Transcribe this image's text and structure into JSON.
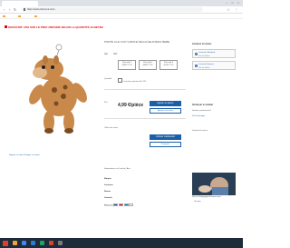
{
  "browser": {
    "tab_title": "",
    "address": "https://www.cdiscount.com/...",
    "bookmarks": [
      "",
      "",
      ""
    ]
  },
  "promo": {
    "text": "DISCOUNT: 20% SUR LE PRIX UNITAIRE SELON LA QUANTITÉ ACHETÉE"
  },
  "product": {
    "title": "PORTE CLE CUIT GIRAFE PELUCHE ANIMAL BEBE",
    "option_label": "Qté",
    "option_value": "Noir",
    "sizes": [
      {
        "line1": "Prix unit 1",
        "line2": "4,99 € TTC"
      },
      {
        "line1": "Prix unit 2",
        "line2": "4,89 € TTC"
      },
      {
        "line1": "Prix unit 3",
        "line2": "4,79 € TTC"
      }
    ],
    "quantity_label": "Quantité",
    "checkbox_label": "Livraison gratuite dès 25€",
    "price": "4,99 €/pièce",
    "price_sub": "",
    "buy_button": "Ajouter au panier",
    "wishlist_button": "Ajouter à ma liste",
    "section_label": "Offres de vente",
    "cart_button": "Acheter maintenant",
    "secondary_button": "Comparer"
  },
  "sidebar": {
    "delivery_header": "Livraison et retours",
    "delivery_option_1_title": "Livraison Standard",
    "delivery_option_1_sub": "Voir les délais",
    "delivery_option_2_title": "Livraison Express",
    "delivery_option_2_sub": "Voir les délais",
    "seller_header": "Vendu par le vendeur",
    "seller_text": "Vendeur professionnel",
    "seller_link": "Voir la boutique",
    "note_text": "Garantie & retours",
    "ad_caption": "Voir le Témoignage de notre client",
    "ad_link": "Voir plus"
  },
  "details": {
    "links": "Informations sur l'article  |  Avis",
    "rows": [
      {
        "label": "Marque",
        "value": ""
      },
      {
        "label": "Livraison",
        "value": ""
      },
      {
        "label": "Retour",
        "value": ""
      },
      {
        "label": "Garantie",
        "value": ""
      },
      {
        "label": "Paiement",
        "value": ""
      }
    ],
    "share_text": "Signaler un abus",
    "share_link": "Partager cet article"
  },
  "taskbar": {
    "clock": ""
  },
  "colors": {
    "accent": "#1b5fa7",
    "promo": "#e30613",
    "taskbar": "#1e2b3a"
  }
}
